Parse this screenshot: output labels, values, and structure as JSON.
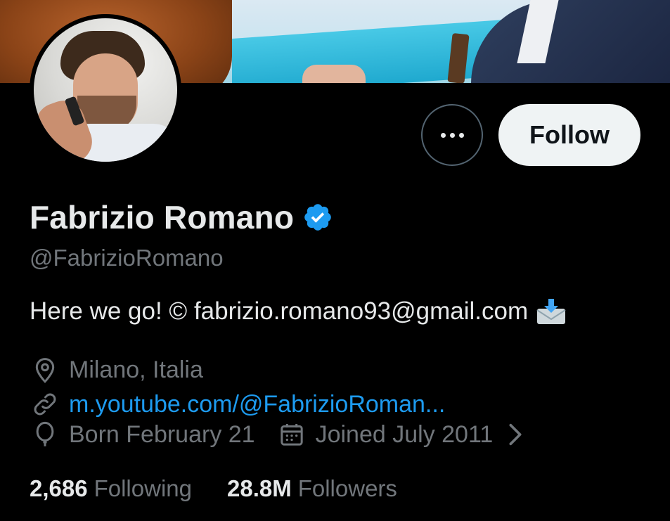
{
  "profile": {
    "name": "Fabrizio Romano",
    "handle": "@FabrizioRomano",
    "bio": "Here we go! © fabrizio.romano93@gmail.com",
    "location": "Milano, Italia",
    "website": "m.youtube.com/@FabrizioRoman...",
    "born": "Born February 21",
    "joined": "Joined July 2011",
    "verified_icon": "verified-badge-icon",
    "bio_emoji": "incoming-envelope-icon"
  },
  "actions": {
    "more_icon": "more-options-icon",
    "follow_label": "Follow"
  },
  "stats": {
    "following_count": "2,686",
    "following_label": "Following",
    "followers_count": "28.8M",
    "followers_label": "Followers"
  },
  "colors": {
    "background": "#000000",
    "text_primary": "#e7e9ea",
    "text_secondary": "#71767b",
    "link": "#1d9bf0",
    "verified": "#1d9bf0",
    "follow_button_bg": "#eff3f4"
  }
}
